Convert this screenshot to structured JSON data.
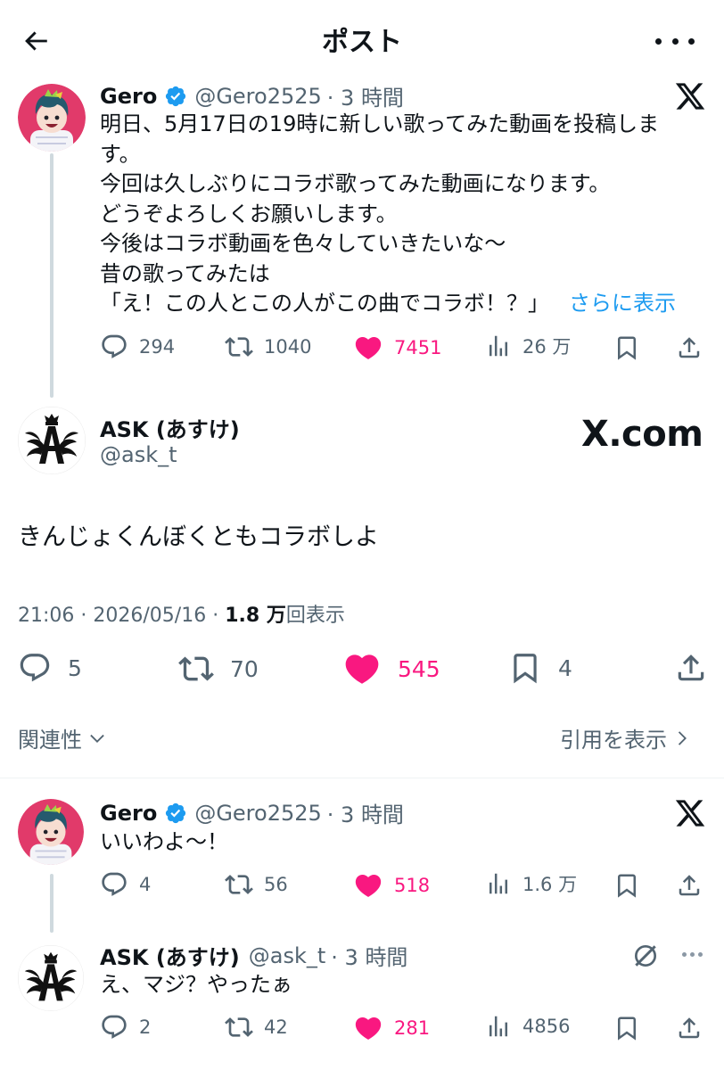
{
  "header": {
    "title": "ポスト"
  },
  "quoted_post": {
    "author_name": "Gero",
    "author_handle": "@Gero2525",
    "time": "· 3 時間",
    "lines": [
      "明日、5月17日の19時に新しい歌ってみた動画を投稿しま",
      "す。",
      "今回は久しぶりにコラボ歌ってみた動画になります。",
      "どうぞよろしくお願いします。",
      "今後はコラボ動画を色々していきたいな〜",
      "昔の歌ってみたは",
      "「え！この人とこの人がこの曲でコラボ！？」"
    ],
    "show_more": "さらに表示",
    "replies": "294",
    "reposts": "1040",
    "likes": "7451",
    "views": "26 万"
  },
  "main_post": {
    "author_name": "ASK (あすけ)",
    "author_handle": "@ask_t",
    "watermark": "X.com",
    "text": "きんじょくんぼくともコラボしよ",
    "time": "21:06",
    "date": "2026/05/16",
    "views_count": "1.8 万",
    "views_label": "回表示",
    "replies": "5",
    "reposts": "70",
    "likes": "545",
    "bookmarks": "4"
  },
  "sort": {
    "relevance": "関連性",
    "quotes": "引用を表示"
  },
  "reply1": {
    "author_name": "Gero",
    "author_handle": "@Gero2525",
    "time": "· 3 時間",
    "text": "いいわよ〜！",
    "replies": "4",
    "reposts": "56",
    "likes": "518",
    "views": "1.6 万"
  },
  "reply2": {
    "author_name": "ASK (あすけ)",
    "author_handle": "@ask_t",
    "time": "· 3 時間",
    "text": "え、マジ？やったぁ",
    "replies": "2",
    "reposts": "42",
    "likes": "281",
    "views": "4856"
  },
  "colors": {
    "like": "#f91880",
    "link": "#1d9bf0",
    "verified": "#1d9bf0",
    "muted": "#536471"
  }
}
